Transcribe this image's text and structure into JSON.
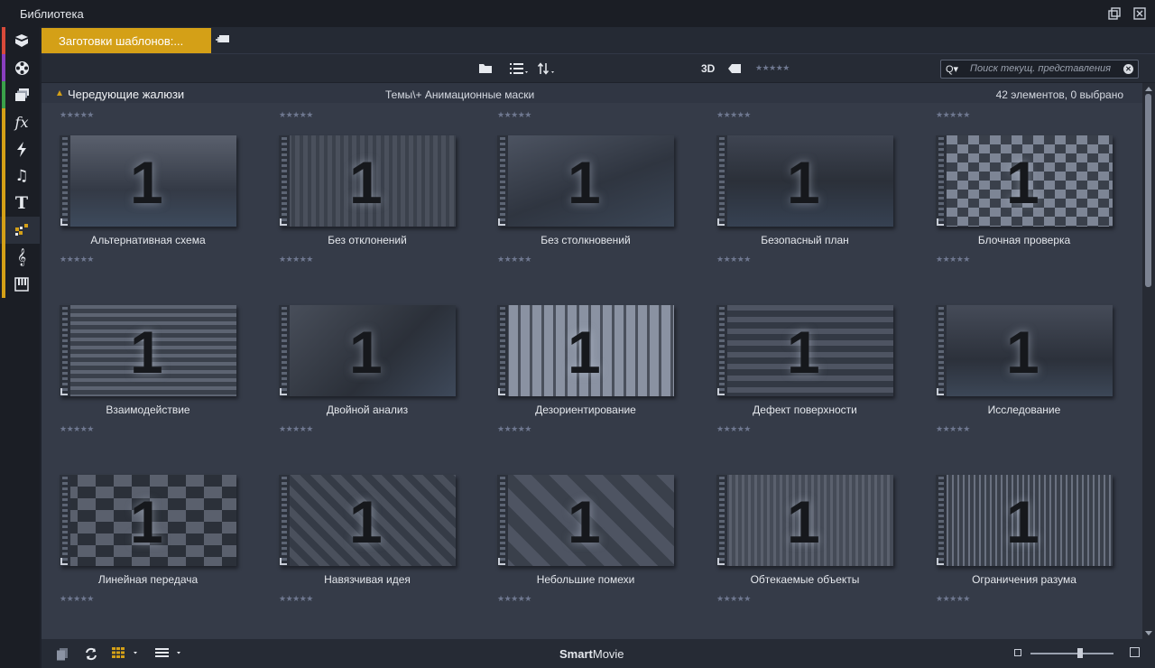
{
  "window": {
    "title": "Библиотека"
  },
  "sidebar": {
    "items": [
      {
        "name": "projects",
        "icon": "box-icon",
        "color": "#d84a3a"
      },
      {
        "name": "transitions",
        "icon": "film-reel-icon",
        "color": "#8a3fbf"
      },
      {
        "name": "media",
        "icon": "clips-icon",
        "color": "#3aa14a"
      },
      {
        "name": "effects",
        "icon": "fx-icon",
        "glyph": "fx",
        "color": "#d4a017"
      },
      {
        "name": "montage",
        "icon": "lightning-icon",
        "color": "#d4a017"
      },
      {
        "name": "audio",
        "icon": "music-note-icon",
        "glyph": "♫",
        "color": "#d4a017"
      },
      {
        "name": "titles",
        "icon": "text-icon",
        "glyph": "T",
        "color": "#d4a017"
      },
      {
        "name": "templates",
        "icon": "templates-icon",
        "color": "#d4a017",
        "active": true
      },
      {
        "name": "scores",
        "icon": "treble-clef-icon",
        "glyph": "𝄞",
        "color": "#d4a017"
      },
      {
        "name": "piano",
        "icon": "piano-icon",
        "color": "#d4a017"
      }
    ]
  },
  "tabs": {
    "active_label": "Заготовки шаблонов:..."
  },
  "toolbar": {
    "label_3d": "3D",
    "stars": "★★★★★",
    "search_glyph": "Q▾",
    "search_placeholder": "Поиск текущ. представления",
    "clear_glyph": "✕"
  },
  "group": {
    "name": "Чередующие жалюзи",
    "path": "Темы\\+ Анимационные маски",
    "count_text": "42 элементов, 0 выбрано"
  },
  "rating_stars": "★★★★★",
  "thumb_number": "1",
  "items": [
    {
      "label": "Альтернативная схема"
    },
    {
      "label": "Без отклонений"
    },
    {
      "label": "Без столкновений"
    },
    {
      "label": "Безопасный план"
    },
    {
      "label": "Блочная проверка"
    },
    {
      "label": "Взаимодействие"
    },
    {
      "label": "Двойной анализ"
    },
    {
      "label": "Дезориентирование"
    },
    {
      "label": "Дефект поверхности"
    },
    {
      "label": "Исследование"
    },
    {
      "label": "Линейная передача"
    },
    {
      "label": "Навязчивая идея"
    },
    {
      "label": "Небольшие помехи"
    },
    {
      "label": "Обтекаемые объекты"
    },
    {
      "label": "Ограничения разума"
    }
  ],
  "bottombar": {
    "smartmovie_bold": "Smart",
    "smartmovie_rest": "Movie",
    "zoom_level": 0.6
  }
}
